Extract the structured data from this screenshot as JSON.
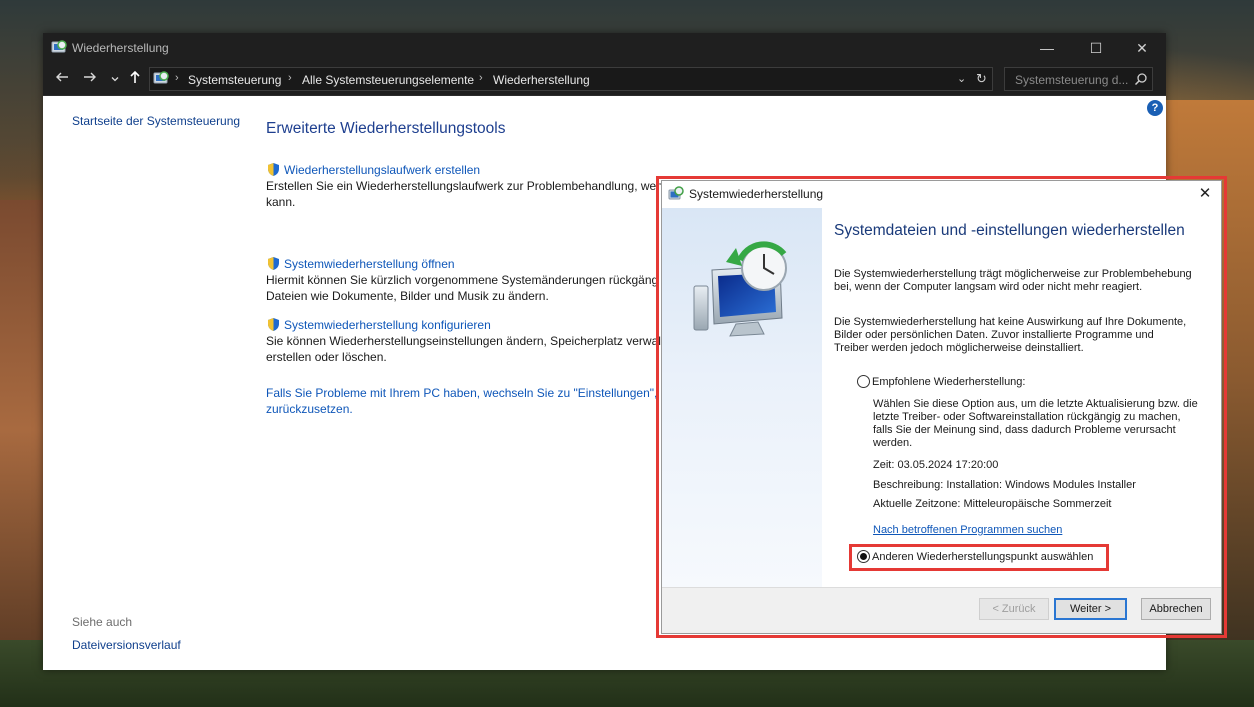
{
  "window": {
    "title": "Wiederherstellung",
    "controls": {
      "minimize": "—",
      "maximize": "☐",
      "close": "✕"
    }
  },
  "nav": {
    "back_icon": "arrow-left-icon",
    "forward_icon": "arrow-right-icon",
    "recent_icon": "chevron-down-icon",
    "up_icon": "arrow-up-icon",
    "breadcrumb": [
      "Systemsteuerung",
      "Alle Systemsteuerungselemente",
      "Wiederherstellung"
    ],
    "search_placeholder": "Systemsteuerung d..."
  },
  "sidebar": {
    "home_link": "Startseite der Systemsteuerung",
    "see_also": "Siehe auch",
    "file_history": "Dateiversionsverlauf"
  },
  "main": {
    "title": "Erweiterte Wiederherstellungstools",
    "tools": [
      {
        "label": "Wiederherstellungslaufwerk erstellen",
        "desc1": "Erstellen Sie ein Wiederherstellungslaufwerk zur Problembehandlung, wen",
        "desc2": "kann."
      },
      {
        "label": "Systemwiederherstellung öffnen",
        "desc1": "Hiermit können Sie kürzlich vorgenommene Systemänderungen rückgäng",
        "desc2": "Dateien wie Dokumente, Bilder und Musik zu ändern."
      },
      {
        "label": "Systemwiederherstellung konfigurieren",
        "desc1": "Sie können Wiederherstellungseinstellungen ändern, Speicherplatz verwalt",
        "desc2": "erstellen oder löschen."
      }
    ],
    "settings_link_1": "Falls Sie Probleme mit Ihrem PC haben, wechseln Sie zu \"Einstellungen\", u",
    "settings_link_2": "zurückzusetzen."
  },
  "dialog": {
    "title": "Systemwiederherstellung",
    "close": "✕",
    "heading": "Systemdateien und -einstellungen wiederherstellen",
    "para1_1": "Die Systemwiederherstellung trägt möglicherweise zur Problembehebung",
    "para1_2": "bei, wenn der Computer langsam wird oder nicht mehr reagiert.",
    "para2_1": "Die Systemwiederherstellung hat keine Auswirkung auf Ihre Dokumente,",
    "para2_2": "Bilder oder persönlichen Daten. Zuvor installierte Programme und",
    "para2_3": "Treiber werden jedoch möglicherweise deinstalliert.",
    "option_recommended": "Empfohlene Wiederherstellung:",
    "rec_desc_1": "Wählen Sie diese Option aus, um die letzte Aktualisierung bzw. die",
    "rec_desc_2": "letzte Treiber- oder Softwareinstallation rückgängig zu machen,",
    "rec_desc_3": "falls Sie der Meinung sind, dass dadurch Probleme verursacht",
    "rec_desc_4": "werden.",
    "time": "Zeit: 03.05.2024 17:20:00",
    "description": "Beschreibung: Installation: Windows Modules Installer",
    "timezone": "Aktuelle Zeitzone: Mitteleuropäische Sommerzeit",
    "affected_link": "Nach betroffenen Programmen suchen",
    "option_other": "Anderen Wiederherstellungspunkt auswählen",
    "selected_option": "other",
    "buttons": {
      "back": "< Zurück",
      "next": "Weiter >",
      "cancel": "Abbrechen"
    }
  },
  "colors": {
    "titlebar": "#1f1f1f",
    "link": "#0f57b9",
    "heading": "#1e3f8f",
    "highlight": "#e53935"
  }
}
